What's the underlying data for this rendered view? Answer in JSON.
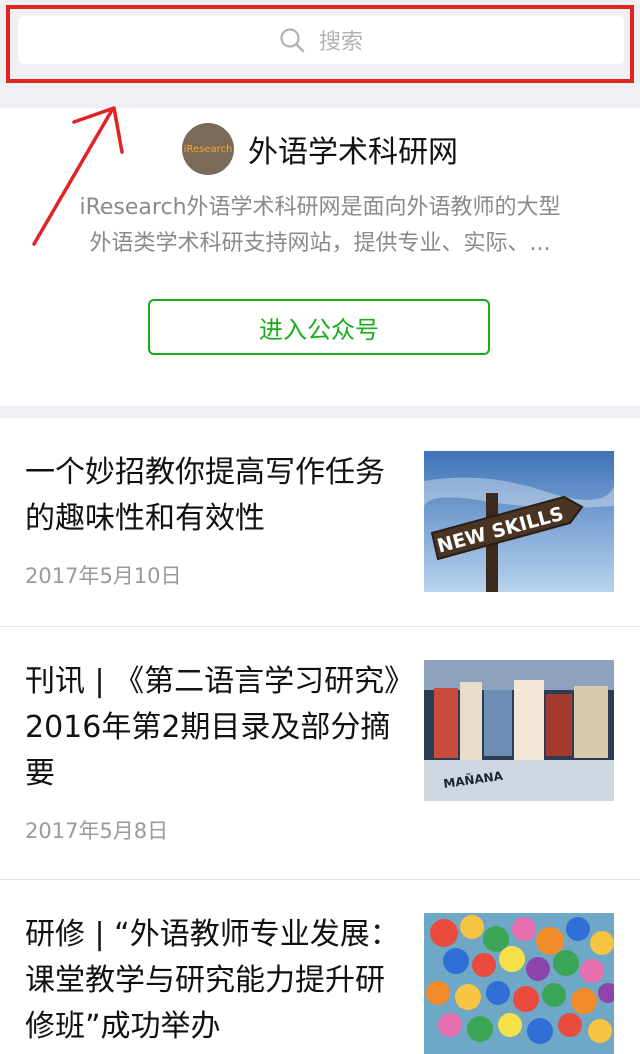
{
  "search": {
    "placeholder_text": "搜索",
    "icon": "search-icon"
  },
  "account": {
    "avatar_text": "iResearch",
    "avatar_subtext": "",
    "name": "外语学术科研网",
    "description_line1": "iResearch外语学术科研网是面向外语教师的大型",
    "description_line2": "外语类学术科研支持网站，提供专业、实际、...",
    "enter_button": "进入公众号",
    "accent_color": "#1aad19"
  },
  "articles": [
    {
      "title": "一个妙招教你提高写作任务的趣味性和有效性",
      "date": "2017年5月10日",
      "thumb_text": "NEW SKILLS"
    },
    {
      "title": "刊讯 | 《第二语言学习研究》2016年第2期目录及部分摘要",
      "date": "2017年5月8日",
      "thumb_text": "MAÑANA"
    },
    {
      "title": "研修 | “外语教师专业发展：课堂教学与研究能力提升研修班”成功举办",
      "date": "",
      "thumb_text": ""
    }
  ]
}
